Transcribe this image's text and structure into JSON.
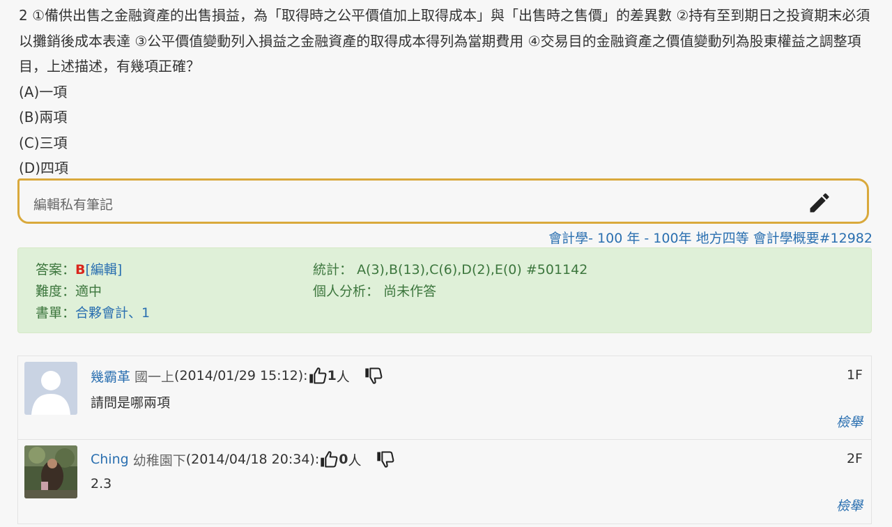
{
  "question": {
    "text": "2 ①備供出售之金融資產的出售損益，為「取得時之公平價值加上取得成本」與「出售時之售價」的差異數 ②持有至到期日之投資期末必須以攤銷後成本表達 ③公平價值變動列入損益之金融資產的取得成本得列為當期費用 ④交易目的金融資產之價值變動列為股東權益之調整項目，上述描述，有幾項正確？",
    "options": [
      "(A)一項",
      "(B)兩項",
      "(C)三項",
      "(D)四項"
    ]
  },
  "note": {
    "placeholder": "編輯私有筆記",
    "icon": "pencil-icon"
  },
  "source": {
    "subject": "會計學",
    "sep1": "- ",
    "year": "100 年",
    "sep2": " - ",
    "exam": "100年 地方四等 會計學概要#12982"
  },
  "answer_panel": {
    "answer_label": "答案：",
    "answer_value": "B",
    "edit_link": "[編輯]",
    "difficulty_label": "難度：",
    "difficulty_value": "適中",
    "booklist_label": "書單：",
    "booklist_value": "合夥會計、1",
    "stats_label": "統計：",
    "stats_value": "A(3),B(13),C(6),D(2),E(0) #501142",
    "personal_label": "個人分析：",
    "personal_value": "尚未作答"
  },
  "comments": [
    {
      "user": "幾霸革",
      "level": "國一上",
      "date": " (2014/01/29 15:12):",
      "likes": "1",
      "unit": "人",
      "floor": "1F",
      "body": "請問是哪兩項",
      "report": "檢舉",
      "avatar": "default-avatar"
    },
    {
      "user": "Ching",
      "level": "幼稚園下",
      "date": " (2014/04/18 20:34):",
      "likes": "0",
      "unit": "人",
      "floor": "2F",
      "body": "2.3",
      "report": "檢舉",
      "avatar": "photo-avatar"
    }
  ],
  "colors": {
    "link": "#2a6fb0",
    "answer_red": "#d9251c",
    "panel_green_bg": "#dff0d8",
    "panel_green_text": "#3c763d",
    "note_border": "#d9a93c"
  }
}
